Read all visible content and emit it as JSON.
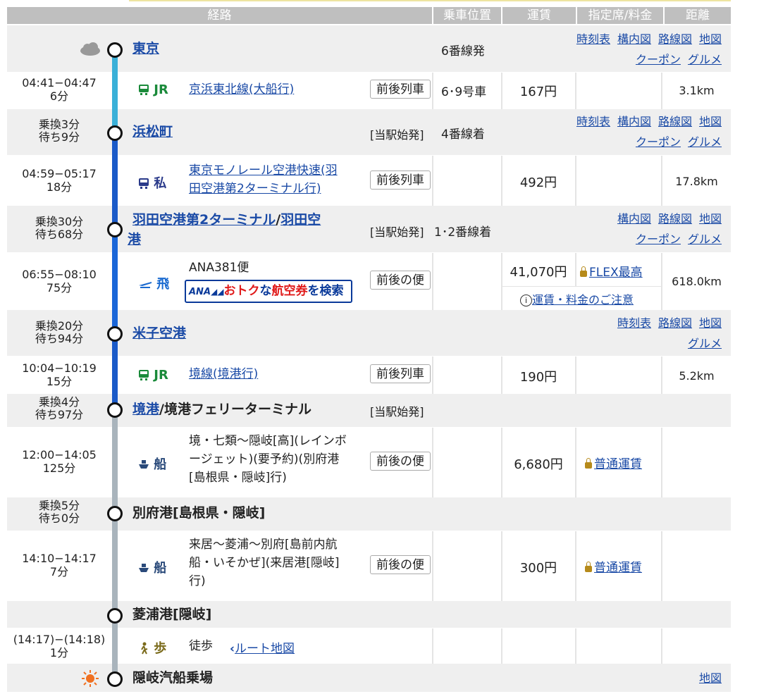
{
  "header": {
    "route": "経路",
    "position": "乗車位置",
    "fare": "運賃",
    "reserved": "指定席/料金",
    "distance": "距離"
  },
  "stations": {
    "tokyo": {
      "name": "東京",
      "pos": "6番線発",
      "links": [
        "時刻表",
        "構内図",
        "路線図",
        "地図",
        "クーポン",
        "グルメ"
      ],
      "weather": "cloud-icon"
    },
    "hamamatsucho": {
      "name": "浜松町",
      "wait1": "乗換3分",
      "wait2": "待ち9分",
      "shiha": "[当駅始発]",
      "pos": "4番線着",
      "links": [
        "時刻表",
        "構内図",
        "路線図",
        "地図",
        "クーポン",
        "グルメ"
      ]
    },
    "haneda": {
      "name1": "羽田空港第2ターミナル",
      "slash": "/",
      "name2": "羽田空",
      "name3": "港",
      "wait1": "乗換30分",
      "wait2": "待ち68分",
      "shiha": "[当駅始発]",
      "pos": "1･2番線着",
      "links": [
        "構内図",
        "路線図",
        "地図",
        "クーポン",
        "グルメ"
      ]
    },
    "yonago": {
      "name": "米子空港",
      "wait1": "乗換20分",
      "wait2": "待ち94分",
      "links": [
        "時刻表",
        "路線図",
        "地図",
        "グルメ"
      ]
    },
    "sakaiminato": {
      "name1": "境港",
      "name2": "/境港フェリーターミナル",
      "wait1": "乗換4分",
      "wait2": "待ち97分",
      "shiha": "[当駅始発]"
    },
    "beppu": {
      "name": "別府港[島根県・隠岐]",
      "wait1": "乗換5分",
      "wait2": "待ち0分"
    },
    "hishiura": {
      "name": "菱浦港[隠岐]"
    },
    "oki": {
      "name": "隠岐汽船乗場",
      "links": [
        "地図"
      ],
      "weather": "sun-icon"
    }
  },
  "sections": [
    {
      "time": "04:41−04:47",
      "dur": "6分",
      "mode_icon": "train-icon",
      "mode": "JR",
      "line": "京浜東北線(大船行)",
      "button": "前後列車",
      "pos": "6･9号車",
      "fare": "167円",
      "dist": "3.1km"
    },
    {
      "time": "04:59−05:17",
      "dur": "18分",
      "mode_icon": "train-icon",
      "mode": "私",
      "line1": "東京モノレール空港快速(羽",
      "line2": "田空港第2ターミナル行)",
      "button": "前後列車",
      "fare": "492円",
      "dist": "17.8km"
    },
    {
      "time": "06:55−08:10",
      "dur": "75分",
      "mode_icon": "plane-icon",
      "mode": "飛",
      "line": "ANA381便",
      "banner_logo": "ANA",
      "banner_a": "おトク",
      "banner_b": "な",
      "banner_c": "航空券",
      "banner_d": "を検索",
      "button": "前後の便",
      "fare": "41,070円",
      "seat": "FLEX最高",
      "note": "運賃・料金のご注意",
      "dist": "618.0km"
    },
    {
      "time": "10:04−10:19",
      "dur": "15分",
      "mode_icon": "train-icon",
      "mode": "JR",
      "line": "境線(境港行)",
      "button": "前後列車",
      "fare": "190円",
      "dist": "5.2km"
    },
    {
      "time": "12:00−14:05",
      "dur": "125分",
      "mode_icon": "ship-icon",
      "mode": "船",
      "line1": "境・七類〜隠岐[高](レインボ",
      "line2": "ージェット)(要予約)(別府港",
      "line3": "[島根県・隠岐]行)",
      "button": "前後の便",
      "fare": "6,680円",
      "seat": "普通運賃"
    },
    {
      "time": "14:10−14:17",
      "dur": "7分",
      "mode_icon": "ship-icon",
      "mode": "船",
      "line1": "来居〜菱浦〜別府[島前内航",
      "line2": "船・いそかぜ](来居港[隠岐]",
      "line3": "行)",
      "button": "前後の便",
      "fare": "300円",
      "seat": "普通運賃"
    },
    {
      "time": "(14:17)−(14:18)",
      "dur": "1分",
      "mode_icon": "walk-icon",
      "mode": "歩",
      "line": "徒歩",
      "map": "ルート地図"
    }
  ],
  "colors": {
    "jr": "#1a8a3a",
    "private": "#2a3a8a",
    "plane": "#1a6ad0",
    "ship": "#2a4a7a",
    "walk": "#7a6a1a",
    "track_light": "#3ab0d8",
    "track_blue": "#1a5ac8",
    "track_mid": "#1a66d8",
    "track_gray": "#a9b4bc"
  }
}
